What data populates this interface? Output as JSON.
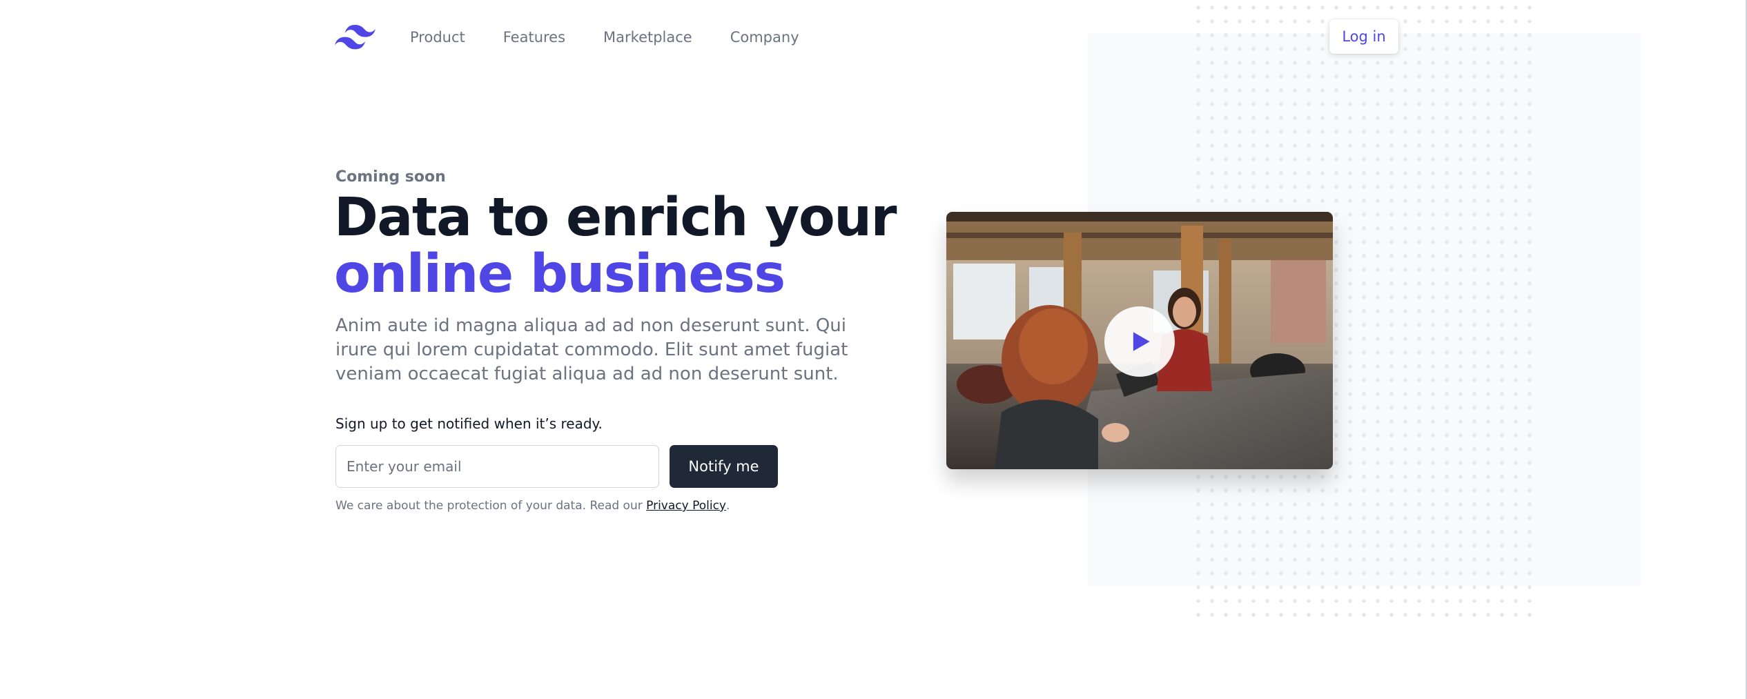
{
  "nav": {
    "logo_icon": "tailwind-logo-icon",
    "links": [
      {
        "label": "Product"
      },
      {
        "label": "Features"
      },
      {
        "label": "Marketplace"
      },
      {
        "label": "Company"
      }
    ],
    "login_label": "Log in"
  },
  "hero": {
    "eyebrow": "Coming soon",
    "headline_line1": "Data to enrich your",
    "headline_line2": "online business",
    "description": "Anim aute id magna aliqua ad ad non deserunt sunt. Qui irure qui lorem cupidatat commodo. Elit sunt amet fugiat veniam occaecat fugiat aliqua ad ad non deserunt sunt."
  },
  "signup": {
    "label": "Sign up to get notified when it’s ready.",
    "email_placeholder": "Enter your email",
    "email_value": "",
    "button_label": "Notify me",
    "privacy_prefix": "We care about the protection of your data. Read our ",
    "privacy_link": "Privacy Policy",
    "privacy_suffix": "."
  },
  "video": {
    "image_subject": "photo-of-two-women-at-a-cafe-counter",
    "play_icon": "play-icon"
  },
  "colors": {
    "accent": "#4f46e5",
    "heading": "#111827",
    "muted": "#6b7280",
    "button_dark": "#1f2937",
    "panel_bg": "#f9fafb"
  }
}
